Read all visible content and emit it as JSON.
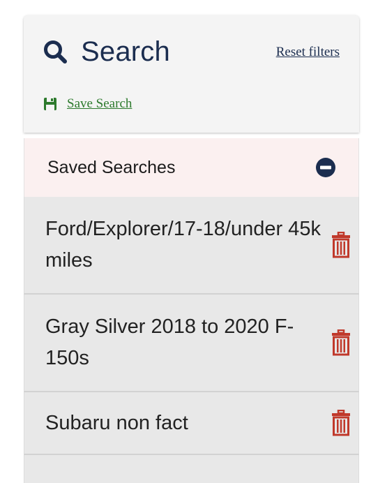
{
  "search_panel": {
    "title": "Search",
    "reset_label": "Reset filters",
    "save_label": "Save Search"
  },
  "saved_searches": {
    "header": "Saved Searches",
    "items": [
      {
        "label": "Ford/Explorer/17-18/under 45k miles"
      },
      {
        "label": "Gray Silver 2018 to 2020 F-150s"
      },
      {
        "label": "Subaru non fact"
      }
    ]
  },
  "icons": {
    "search": "search-icon",
    "save": "floppy-disk-icon",
    "collapse": "minus-circle-icon",
    "delete": "trash-icon"
  },
  "colors": {
    "title_navy": "#1b2d4f",
    "save_green": "#2d7a2d",
    "trash_red": "#c0392b",
    "header_bg": "#fbf0f0",
    "item_bg": "#e8e8e8"
  }
}
